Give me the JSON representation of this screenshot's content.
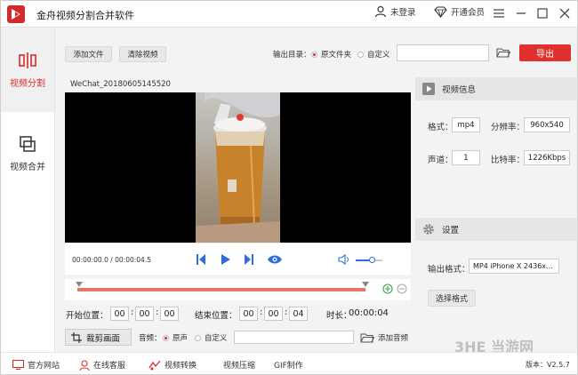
{
  "app": {
    "title": "金舟视频分割合并软件"
  },
  "header": {
    "login_label": "未登录",
    "vip_label": "开通会员"
  },
  "sidebar": {
    "items": [
      {
        "label": "视频分割",
        "icon": "split-icon",
        "active": true
      },
      {
        "label": "视频合并",
        "icon": "merge-icon",
        "active": false
      }
    ]
  },
  "toolbar": {
    "add_file": "添加文件",
    "clear_video": "清除视频",
    "output_dir_label": "输出目录：",
    "output_options": [
      "原文件夹",
      "自定义"
    ],
    "output_selected": "原文件夹",
    "output_path": "",
    "export_label": "导出"
  },
  "player": {
    "filename": "WeChat_20180605145520",
    "current_time": "00:00:00.0",
    "total_time": "00:00:04.5",
    "time_display": "00:00:00.0 / 00:00:04.5",
    "volume": 0.6
  },
  "range": {
    "start_label": "开始位置：",
    "start": [
      "00",
      "00",
      "00"
    ],
    "end_label": "结束位置：",
    "end": [
      "00",
      "00",
      "04"
    ],
    "duration_label": "时长：",
    "duration": "00:00:04"
  },
  "options": {
    "crop_label": "裁剪画面",
    "audio_label": "音频：",
    "audio_options": [
      "原声",
      "自定义"
    ],
    "audio_selected": "原声",
    "audio_path": "",
    "add_audio": "添加音频"
  },
  "info": {
    "title": "视频信息",
    "format_label": "格式：",
    "format": "mp4",
    "resolution_label": "分辨率：",
    "resolution": "960x540",
    "channels_label": "声道：",
    "channels": "1",
    "bitrate_label": "比特率：",
    "bitrate": "1226Kbps"
  },
  "settings": {
    "title": "设置",
    "output_format_label": "输出格式：",
    "output_format": "MP4 iPhone X 2436x...",
    "choose_format": "选择格式"
  },
  "statusbar": {
    "items": [
      {
        "label": "官方网站",
        "icon": "monitor-icon"
      },
      {
        "label": "在线客服",
        "icon": "support-icon"
      },
      {
        "label": "视频转换",
        "icon": "convert-icon"
      },
      {
        "label": "视频压缩",
        "icon": ""
      },
      {
        "label": "GIF制作",
        "icon": ""
      }
    ],
    "version": "版本：V2.5.7"
  },
  "watermark": {
    "text": "3HE 当游网"
  },
  "colors": {
    "accent": "#e0312e",
    "track": "#e77668",
    "player_icon": "#2d6fd6",
    "plus": "#3aa33a"
  }
}
